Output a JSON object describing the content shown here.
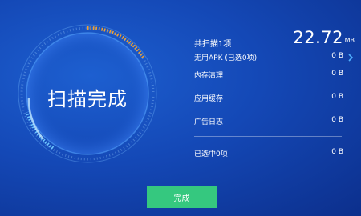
{
  "scan": {
    "status_title": "扫描完成",
    "summary_label": "共扫描1项",
    "total_size": "22.72",
    "total_unit": "MB"
  },
  "items": [
    {
      "label": "无用APK (已选0项)",
      "value": "0 B"
    },
    {
      "label": "内存清理",
      "value": "0 B"
    },
    {
      "label": "应用缓存",
      "value": "0 B"
    },
    {
      "label": "广告日志",
      "value": "0 B"
    }
  ],
  "selection": {
    "label": "已选中0项",
    "value": "0 B"
  },
  "done_button": {
    "label": "完成"
  },
  "icons": {
    "expand": "chevron-right-icon"
  },
  "colors": {
    "accent_green": "#35c87f",
    "ring_orange": "#f0a030",
    "ring_blue": "#5ab8ff"
  }
}
